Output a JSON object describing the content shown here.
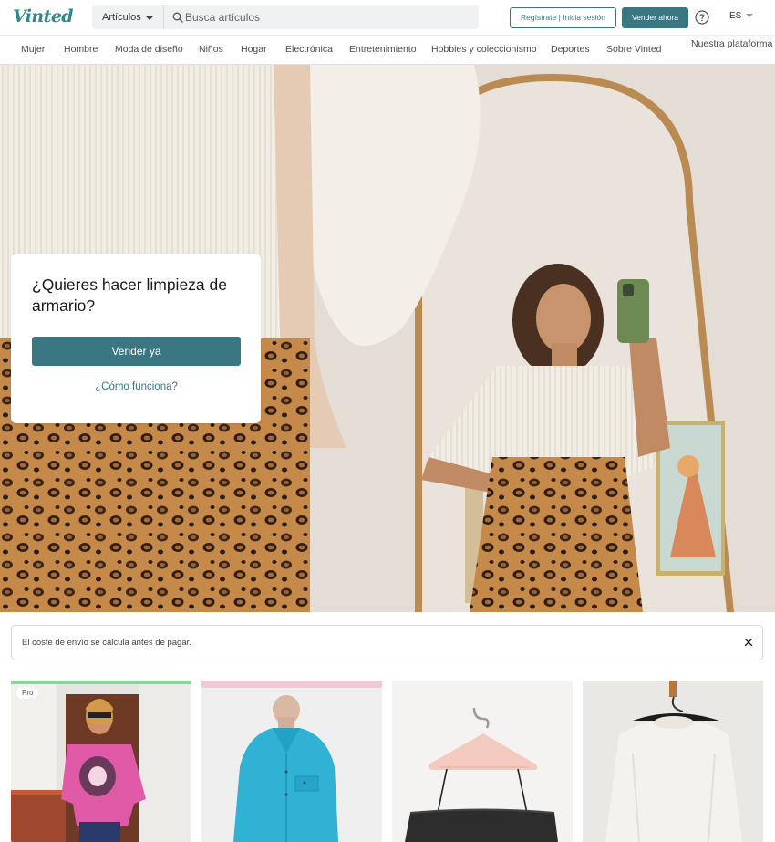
{
  "header": {
    "logo": "Vinted",
    "search": {
      "category": "Artículos",
      "placeholder": "Busca artículos"
    },
    "auth_label": "Regístrate | Inicia sesión",
    "sell_label": "Vender ahora",
    "help_icon": "question-circle-icon",
    "language": "ES"
  },
  "categories": [
    "Mujer",
    "Hombre",
    "Moda de diseño",
    "Niños",
    "Hogar",
    "Electrónica",
    "Entretenimiento",
    "Hobbies y coleccionismo",
    "Deportes",
    "Sobre Vinted",
    "Nuestra plataforma"
  ],
  "hero": {
    "title": "¿Quieres hacer limpieza de armario?",
    "sell_button": "Vender ya",
    "how_link": "¿Cómo funciona?"
  },
  "notice": {
    "text": "El coste de envío se calcula antes de pagar.",
    "close_icon": "close-icon"
  },
  "items": [
    {
      "badge": "Pro",
      "description": "woman in pink patterned sweater"
    },
    {
      "badge": "",
      "description": "turquoise blouse on mannequin"
    },
    {
      "badge": "",
      "description": "black top on pink hanger"
    },
    {
      "badge": "",
      "description": "white knit sweater on hanger"
    }
  ],
  "colors": {
    "brand": "#3a7782",
    "logo": "#2e8a8e",
    "pro_top": "#86d89a"
  }
}
